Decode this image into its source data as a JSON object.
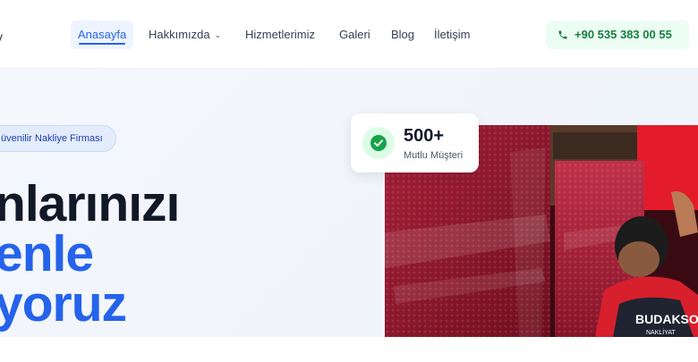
{
  "header": {
    "logo_fragment": "y",
    "nav": [
      {
        "label": "Anasayfa",
        "active": true
      },
      {
        "label": "Hakkımızda",
        "has_dropdown": true
      },
      {
        "label": "Hizmetlerimiz"
      },
      {
        "label": "Galeri"
      },
      {
        "label": "Blog"
      },
      {
        "label": "İletişim"
      }
    ],
    "phone": "+90 535 383 00 55"
  },
  "hero": {
    "badge": "üvenilir Nakliye Firması",
    "headline_line1": "nlarınızı",
    "headline_line2": "enle",
    "headline_line3": "yoruz"
  },
  "stat_card": {
    "number": "500+",
    "label": "Mutlu Müşteri"
  },
  "photo": {
    "vest_text_1": "BUDAKSO",
    "vest_text_2": "NAKLİYAT"
  },
  "colors": {
    "accent": "#2563eb",
    "phone_green": "#15803d",
    "phone_bg": "#ecfdf3",
    "badge_bg": "#e3ecfb",
    "headline_dark": "#111827"
  },
  "icons": {
    "phone": "phone-icon",
    "check": "check-circle-icon",
    "chevron": "chevron-down-icon"
  }
}
